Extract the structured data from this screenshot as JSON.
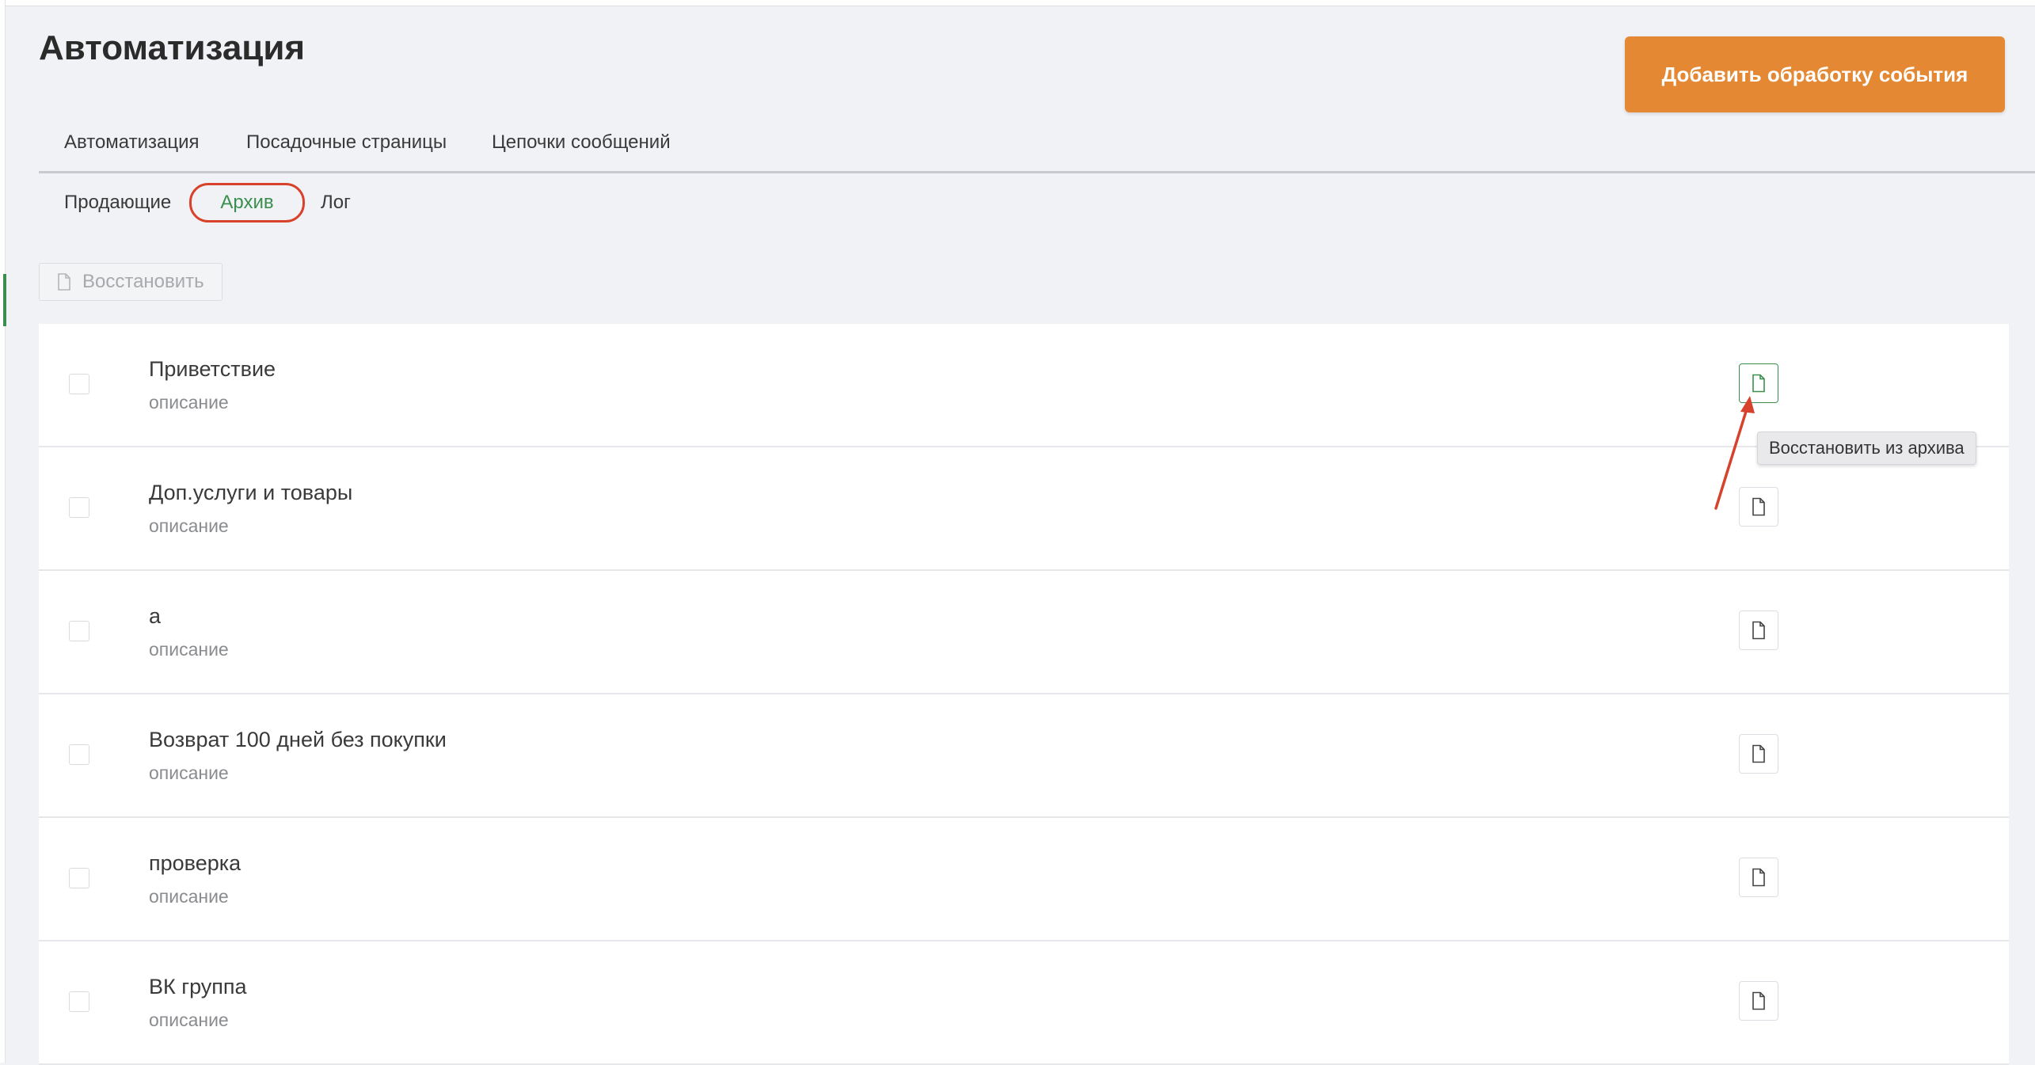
{
  "page": {
    "title": "Автоматизация",
    "add_button_label": "Добавить обработку события"
  },
  "tabs": [
    {
      "label": "Автоматизация"
    },
    {
      "label": "Посадочные страницы"
    },
    {
      "label": "Цепочки сообщений"
    }
  ],
  "subtabs": [
    {
      "label": "Продающие"
    },
    {
      "label": "Архив",
      "active": true
    },
    {
      "label": "Лог"
    }
  ],
  "toolbar": {
    "restore_label": "Восстановить",
    "restore_icon": "file-icon"
  },
  "rows": [
    {
      "title": "Приветствие",
      "description": "описание"
    },
    {
      "title": "Доп.услуги и товары",
      "description": "описание"
    },
    {
      "title": "а",
      "description": "описание"
    },
    {
      "title": "Возврат 100 дней без покупки",
      "description": "описание"
    },
    {
      "title": "проверка",
      "description": "описание"
    },
    {
      "title": "ВК группа",
      "description": "описание"
    }
  ],
  "tooltip": {
    "text": "Восстановить из архива"
  },
  "colors": {
    "accent_orange": "#e48833",
    "active_green": "#3b8f4e",
    "highlight_red": "#d8412b",
    "background": "#f1f2f5"
  }
}
